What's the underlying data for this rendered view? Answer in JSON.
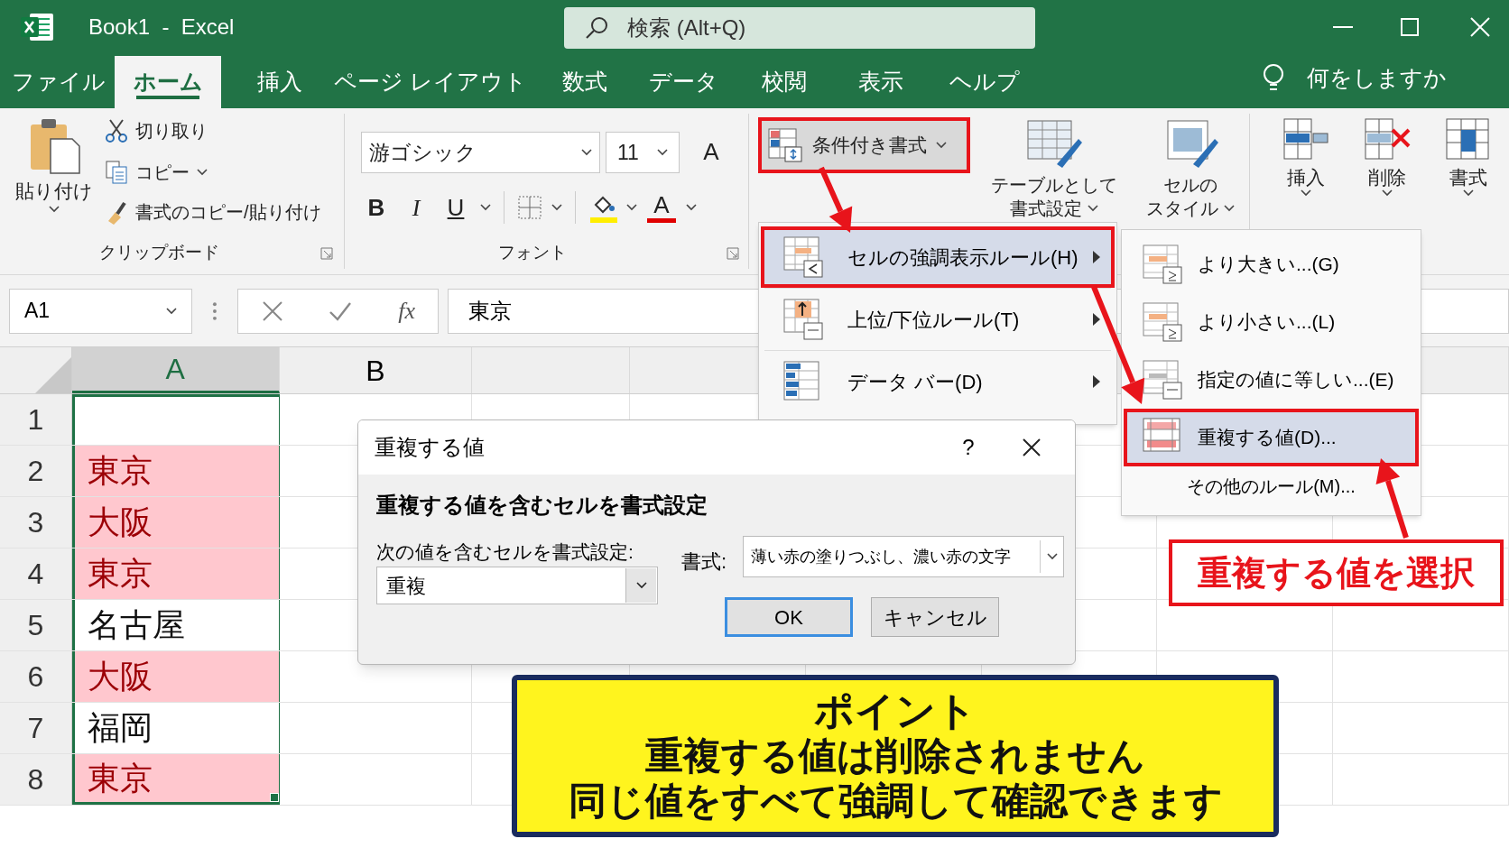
{
  "window": {
    "title": "Book1  -  Excel",
    "search": "検索 (Alt+Q)"
  },
  "tabs": [
    {
      "label": "ファイル",
      "selected": false
    },
    {
      "label": "ホーム",
      "selected": true
    },
    {
      "label": "挿入",
      "selected": false
    },
    {
      "label": "ページ レイアウト",
      "selected": false
    },
    {
      "label": "数式",
      "selected": false
    },
    {
      "label": "データ",
      "selected": false
    },
    {
      "label": "校閲",
      "selected": false
    },
    {
      "label": "表示",
      "selected": false
    },
    {
      "label": "ヘルプ",
      "selected": false
    }
  ],
  "tell_me": "何をしますか",
  "ribbon": {
    "clipboard": {
      "paste": "貼り付け",
      "cut": "切り取り",
      "copy": "コピー",
      "format_painter": "書式のコピー/貼り付け",
      "group_label": "クリップボード"
    },
    "font": {
      "name": "游ゴシック",
      "size": "11",
      "grow": "A",
      "bold": "B",
      "italic": "I",
      "underline": "U",
      "font_color": "A",
      "group_label": "フォント"
    },
    "styles": {
      "conditional_formatting": "条件付き書式",
      "format_as_table": [
        "テーブルとして",
        "書式設定"
      ],
      "cell_styles": [
        "セルの",
        "スタイル"
      ]
    },
    "cells": [
      {
        "kind": "insert",
        "label": "挿入"
      },
      {
        "kind": "delete",
        "label": "削除"
      },
      {
        "kind": "format",
        "label": "書式"
      }
    ]
  },
  "formula_bar": {
    "name_box": "A1",
    "fx": "fx",
    "value": "東京"
  },
  "sheet": {
    "columns": [
      {
        "label": "A",
        "selected": true
      },
      {
        "label": "B",
        "selected": false
      }
    ],
    "rows": [
      {
        "number": "1",
        "highlighted": false
      },
      {
        "number": "2",
        "value": "東京",
        "highlighted": true
      },
      {
        "number": "3",
        "value": "大阪",
        "highlighted": true
      },
      {
        "number": "4",
        "value": "東京",
        "highlighted": true
      },
      {
        "number": "5",
        "value": "名古屋",
        "highlighted": false
      },
      {
        "number": "6",
        "value": "大阪",
        "highlighted": true
      },
      {
        "number": "7",
        "value": "福岡",
        "highlighted": false
      },
      {
        "number": "8",
        "value": "東京",
        "highlighted": true
      }
    ]
  },
  "menu": {
    "items": [
      {
        "kind": "highlight",
        "label": "セルの強調表示ルール(H)",
        "selected": true
      },
      {
        "kind": "topbottom",
        "label": "上位/下位ルール(T)",
        "selected": false
      },
      {
        "kind": "databar",
        "label": "データ バー(D)",
        "selected": false
      }
    ]
  },
  "submenu": {
    "items": [
      {
        "kind": "greater",
        "label": "より大きい...(G)",
        "selected": false
      },
      {
        "kind": "less",
        "label": "より小さい...(L)",
        "selected": false
      },
      {
        "kind": "equal",
        "label": "指定の値に等しい...(E)",
        "selected": false
      },
      {
        "kind": "duplicate",
        "label": "重複する値(D)...",
        "selected": true
      },
      {
        "kind": "more",
        "label": "その他のルール(M)...",
        "selected": false
      }
    ]
  },
  "dialog": {
    "title": "重複する値",
    "help": "?",
    "heading": "重複する値を含むセルを書式設定",
    "field_label": "次の値を含むセルを書式設定:",
    "field_value": "重複",
    "format_label": "書式:",
    "format_value": "薄い赤の塗りつぶし、濃い赤の文字",
    "buttons": [
      {
        "label": "OK",
        "default": true
      },
      {
        "label": "キャンセル",
        "default": false
      }
    ]
  },
  "callout": "重複する値を選択",
  "note": {
    "title": "ポイント",
    "lines": [
      "重複する値は削除されません",
      "同じ値をすべて強調して確認できます"
    ]
  }
}
